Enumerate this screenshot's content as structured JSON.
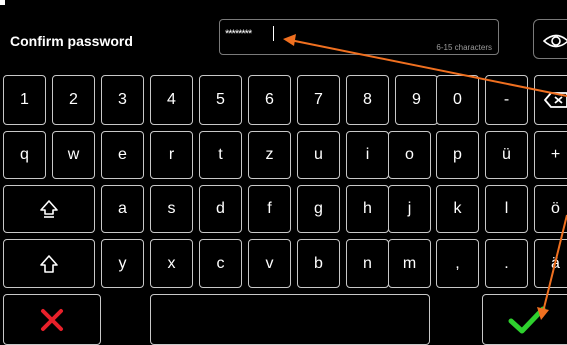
{
  "dialog": {
    "title": "Confirm password",
    "password_value": "********",
    "password_hint": "6-15 characters"
  },
  "keyboard": {
    "rows": [
      [
        "1",
        "2",
        "3",
        "4",
        "5",
        "6",
        "7",
        "8",
        "9",
        "0",
        "-"
      ],
      [
        "q",
        "w",
        "e",
        "r",
        "t",
        "z",
        "u",
        "i",
        "o",
        "p",
        "ü",
        "+"
      ],
      [
        "a",
        "s",
        "d",
        "f",
        "g",
        "h",
        "j",
        "k",
        "l",
        "ö"
      ],
      [
        "y",
        "x",
        "c",
        "v",
        "b",
        "n",
        "m",
        ",",
        ".",
        "ä"
      ]
    ]
  },
  "icons": {
    "eye": "eye-icon",
    "backspace": "backspace-icon",
    "caps_lock": "caps-lock-icon",
    "shift": "shift-icon",
    "cancel": "cross-icon",
    "confirm": "checkmark-icon"
  },
  "colors": {
    "background": "#000000",
    "key_border": "#c8c8c8",
    "cancel": "#e8202a",
    "confirm": "#2ed12e",
    "annotation": "#f07020"
  }
}
